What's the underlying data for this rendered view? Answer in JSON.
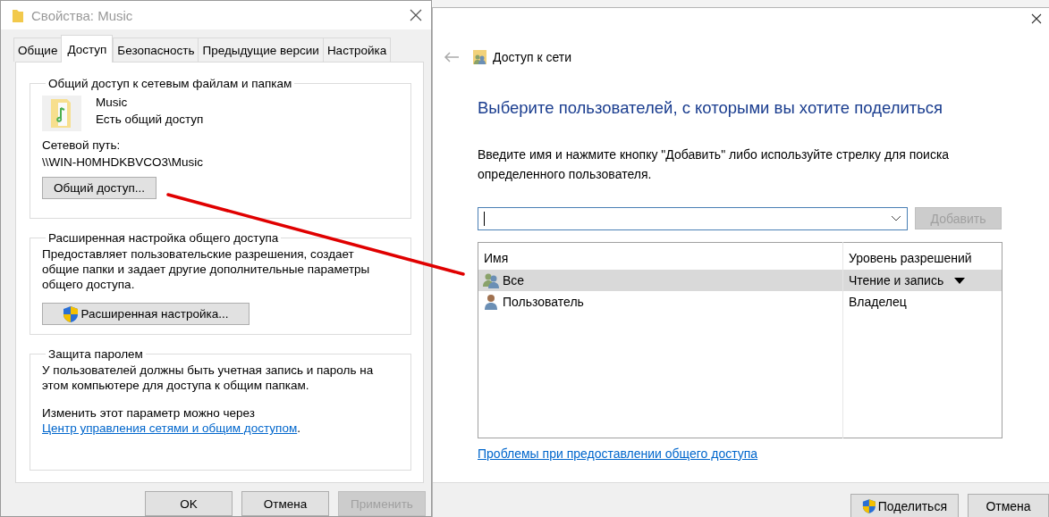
{
  "properties_window": {
    "title": "Свойства: Music",
    "tabs": [
      {
        "label": "Общие",
        "selected": false
      },
      {
        "label": "Доступ",
        "selected": true
      },
      {
        "label": "Безопасность",
        "selected": false
      },
      {
        "label": "Предыдущие версии",
        "selected": false
      },
      {
        "label": "Настройка",
        "selected": false
      }
    ],
    "network_sharing": {
      "heading": "Общий доступ к сетевым файлам и папкам",
      "folder_name": "Music",
      "status": "Есть общий доступ",
      "path_label": "Сетевой путь:",
      "path": "\\\\WIN-H0MHDKBVCO3\\Music",
      "button": {
        "label": "Общий доступ...",
        "uac": false
      }
    },
    "advanced": {
      "heading": "Расширенная настройка общего доступа",
      "description": "Предоставляет пользовательские разрешения, создает общие папки и задает другие дополнительные параметры общего доступа.",
      "button": {
        "label": "Расширенная настройка...",
        "uac": true
      }
    },
    "password": {
      "heading": "Защита паролем",
      "description": "У пользователей должны быть учетная запись и пароль на этом компьютере для доступа к общим папкам.",
      "note": "Изменить этот параметр можно через ",
      "link": "Центр управления сетями и общим доступом",
      "note_end": "."
    },
    "buttons": [
      {
        "label": "OK",
        "disabled": false
      },
      {
        "label": "Отмена",
        "disabled": false
      },
      {
        "label": "Применить",
        "disabled": true
      }
    ]
  },
  "share_window": {
    "title": "Доступ к сети",
    "heading": "Выберите пользователей, с которыми вы хотите поделиться",
    "instructions": "Введите имя и нажмите кнопку \"Добавить\" либо используйте стрелку для поиска определенного пользователя.",
    "add_button": {
      "label": "Добавить",
      "disabled": true
    },
    "table": {
      "columns": [
        "Имя",
        "Уровень разрешений"
      ],
      "rows": [
        {
          "name": "Все",
          "permission": "Чтение и запись",
          "kind": "group",
          "selected": true
        },
        {
          "name": "Пользователь",
          "permission": "Владелец",
          "kind": "user",
          "selected": false
        }
      ]
    },
    "help_link": "Проблемы при предоставлении общего доступа",
    "buttons": [
      {
        "label": "Поделиться",
        "disabled": false,
        "uac": true
      },
      {
        "label": "Отмена",
        "disabled": false,
        "uac": false
      }
    ]
  }
}
